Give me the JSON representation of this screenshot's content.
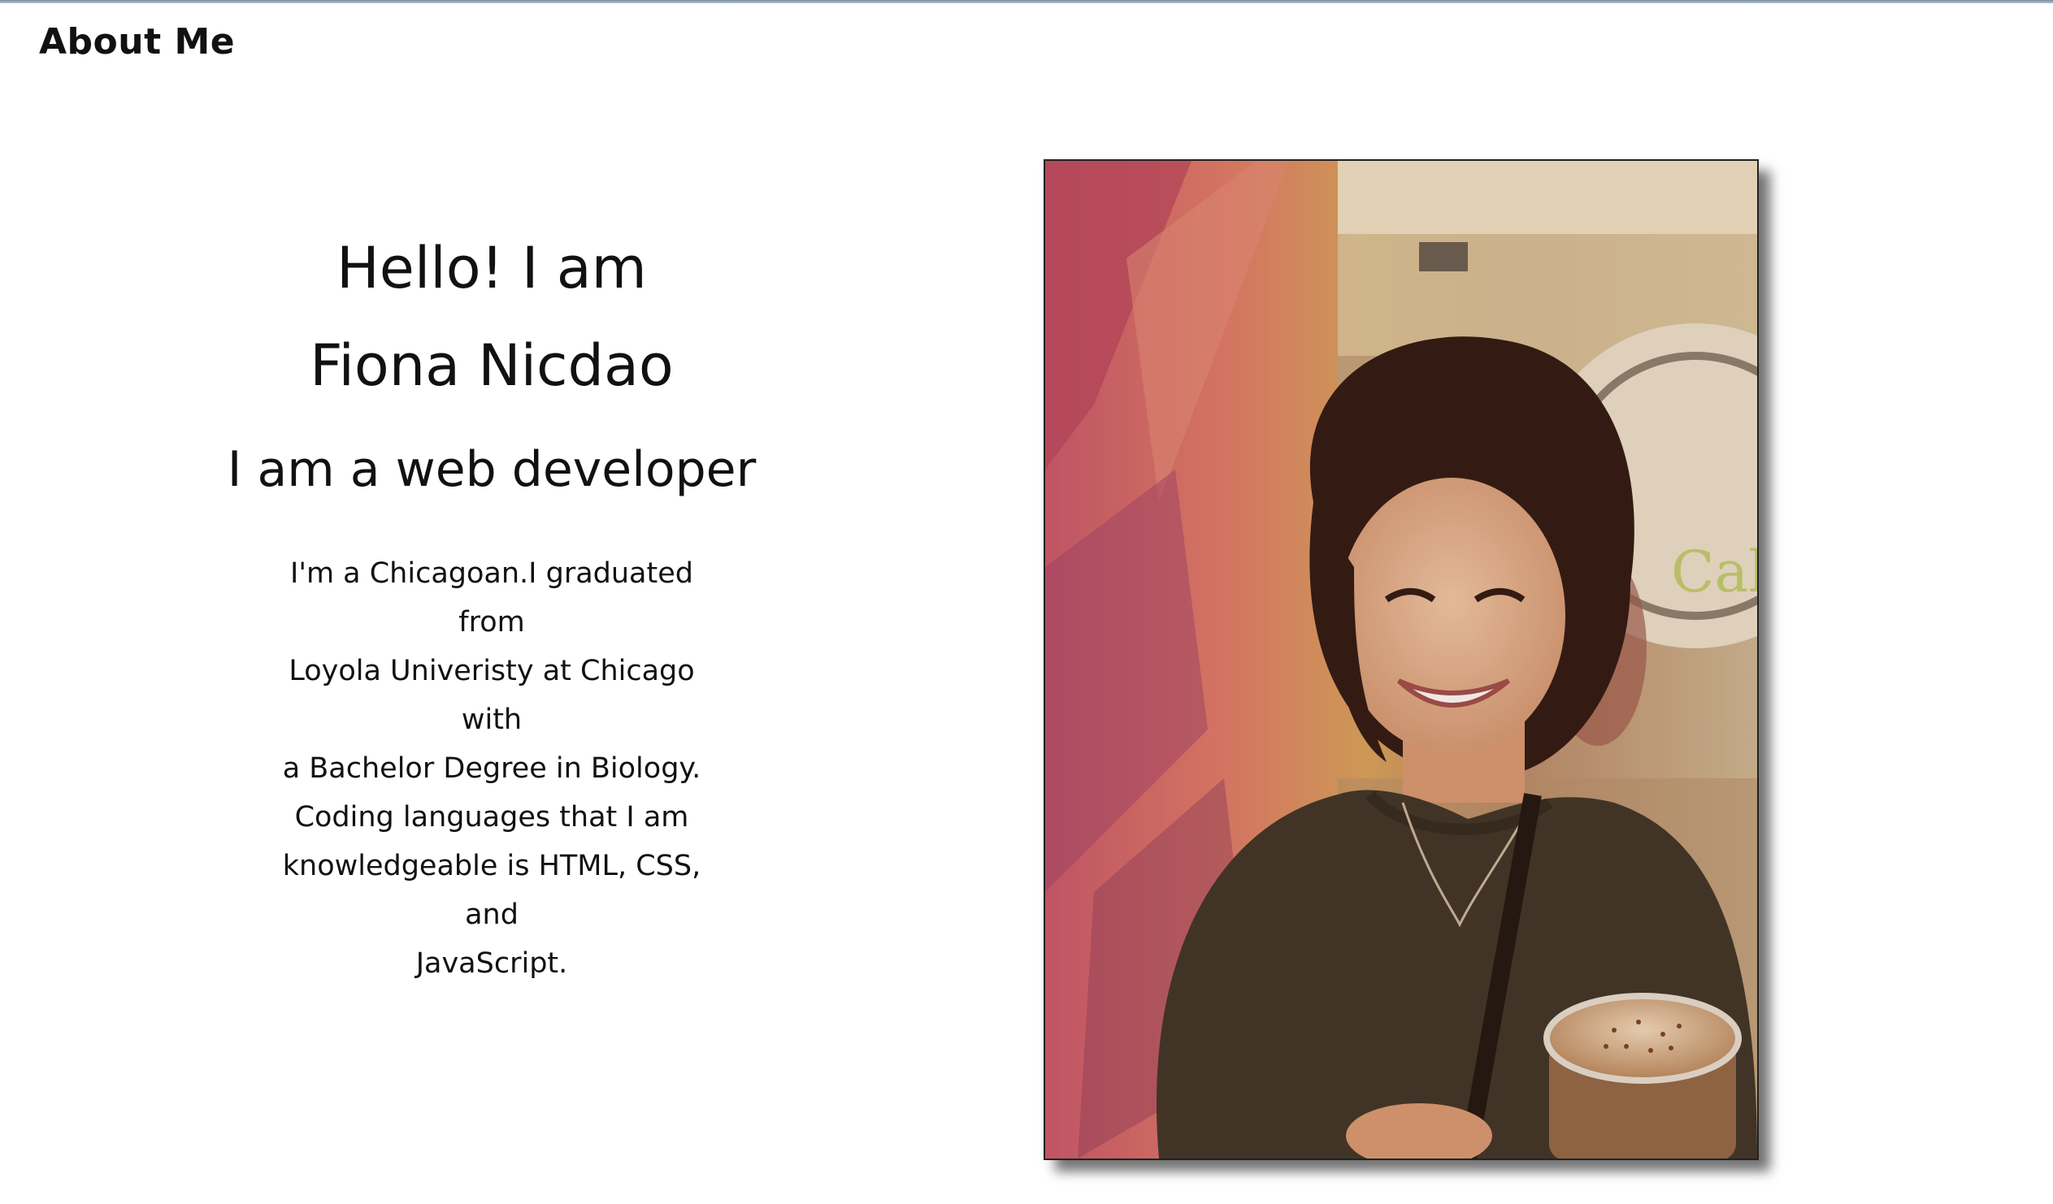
{
  "header": {
    "title": "About Me"
  },
  "intro": {
    "greeting_line1": "Hello! I am",
    "greeting_line2": "Fiona Nicdao",
    "role": "I am a web developer",
    "bio_lines": [
      "I'm a Chicagoan.I graduated from",
      "Loyola Univeristy at Chicago with",
      "a Bachelor Degree in Biology.",
      "Coding languages that I am",
      "knowledgeable is HTML, CSS, and",
      "JavaScript."
    ]
  },
  "photo": {
    "alt": "portrait-photo"
  }
}
